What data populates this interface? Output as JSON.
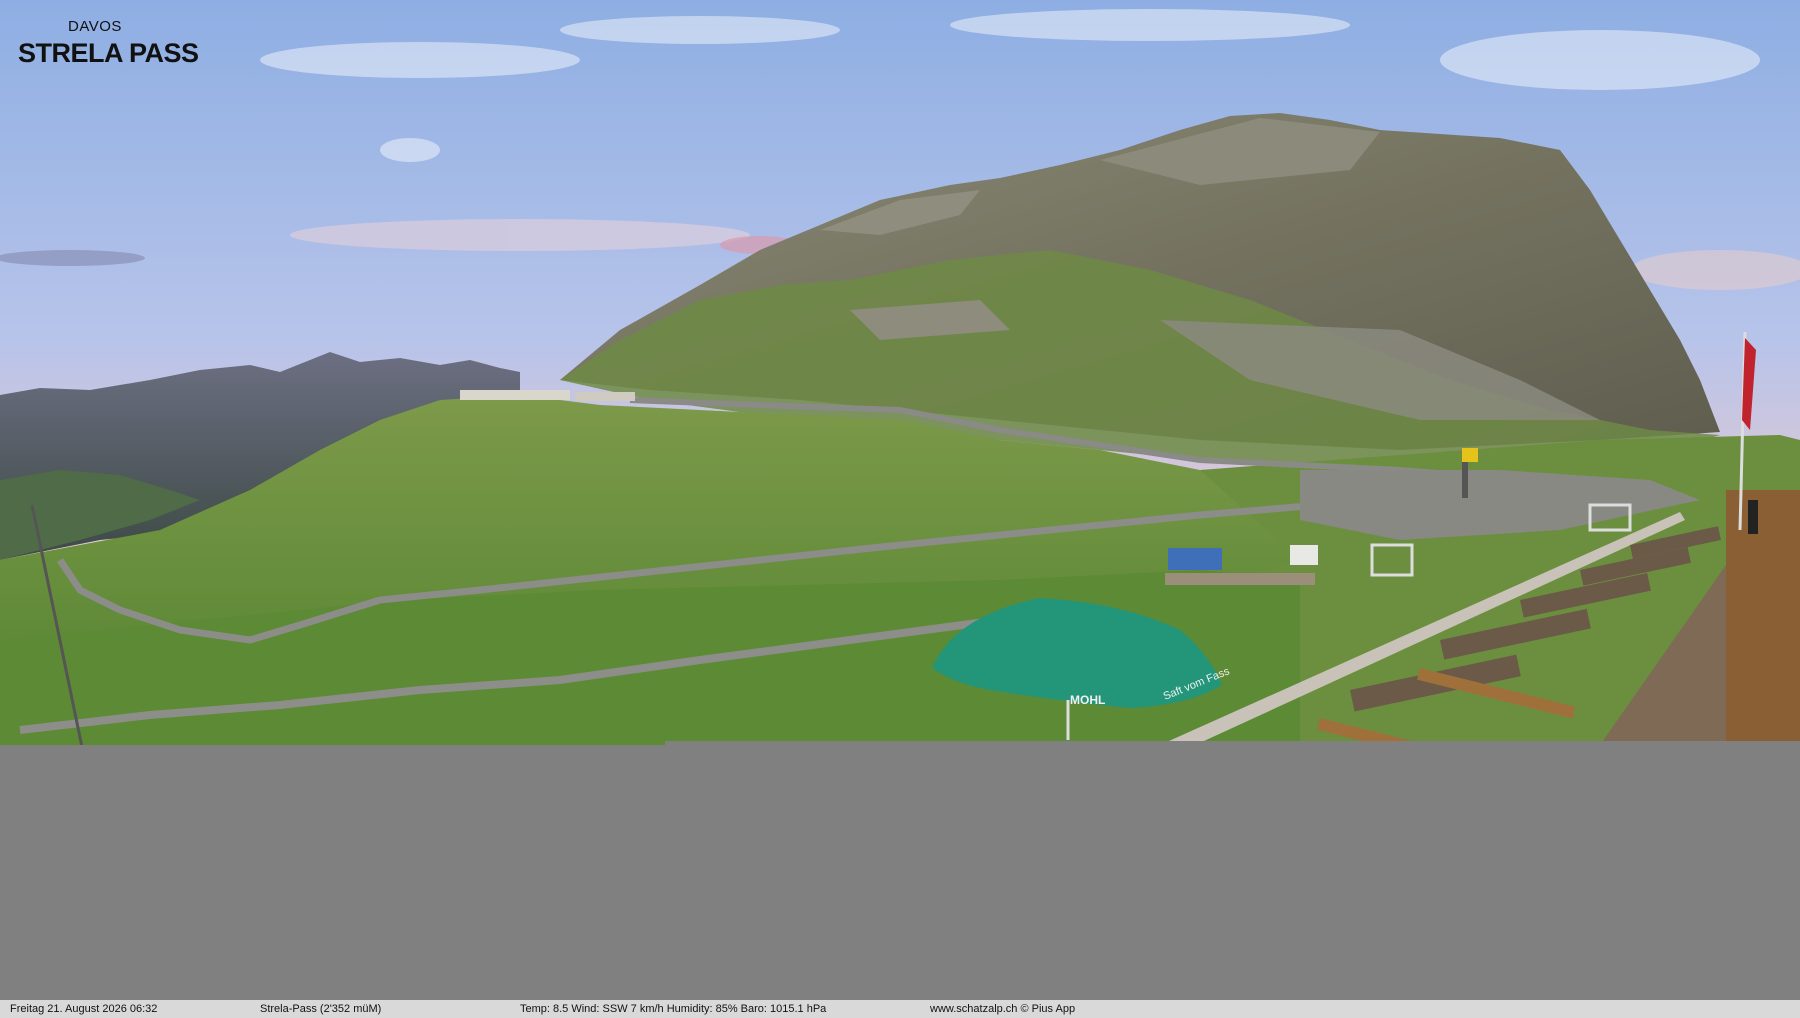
{
  "logo": {
    "line1": "DAVOS",
    "line2": "STRELA PASS"
  },
  "status_bar": {
    "datetime": "Freitag  21. August 2026  06:32",
    "location": "Strela-Pass (2'352 müM)",
    "weather": "Temp: 8.5  Wind: SSW 7 km/h  Humidity: 85%  Baro: 1015.1 hPa",
    "credits": "www.schatzalp.ch © Pius App"
  },
  "umbrella": {
    "brand_text": "MOHL",
    "slogan_text": "Saft vom Fass"
  },
  "colors": {
    "sky_top": "#8fb0e6",
    "sky_horizon": "#f5c9c0",
    "grass": "#6e9a3e",
    "rock": "#7c7a6c",
    "umbrella": "#1f8a6c",
    "gray_fill": "#808080",
    "status_bar": "#d9d9d9"
  }
}
